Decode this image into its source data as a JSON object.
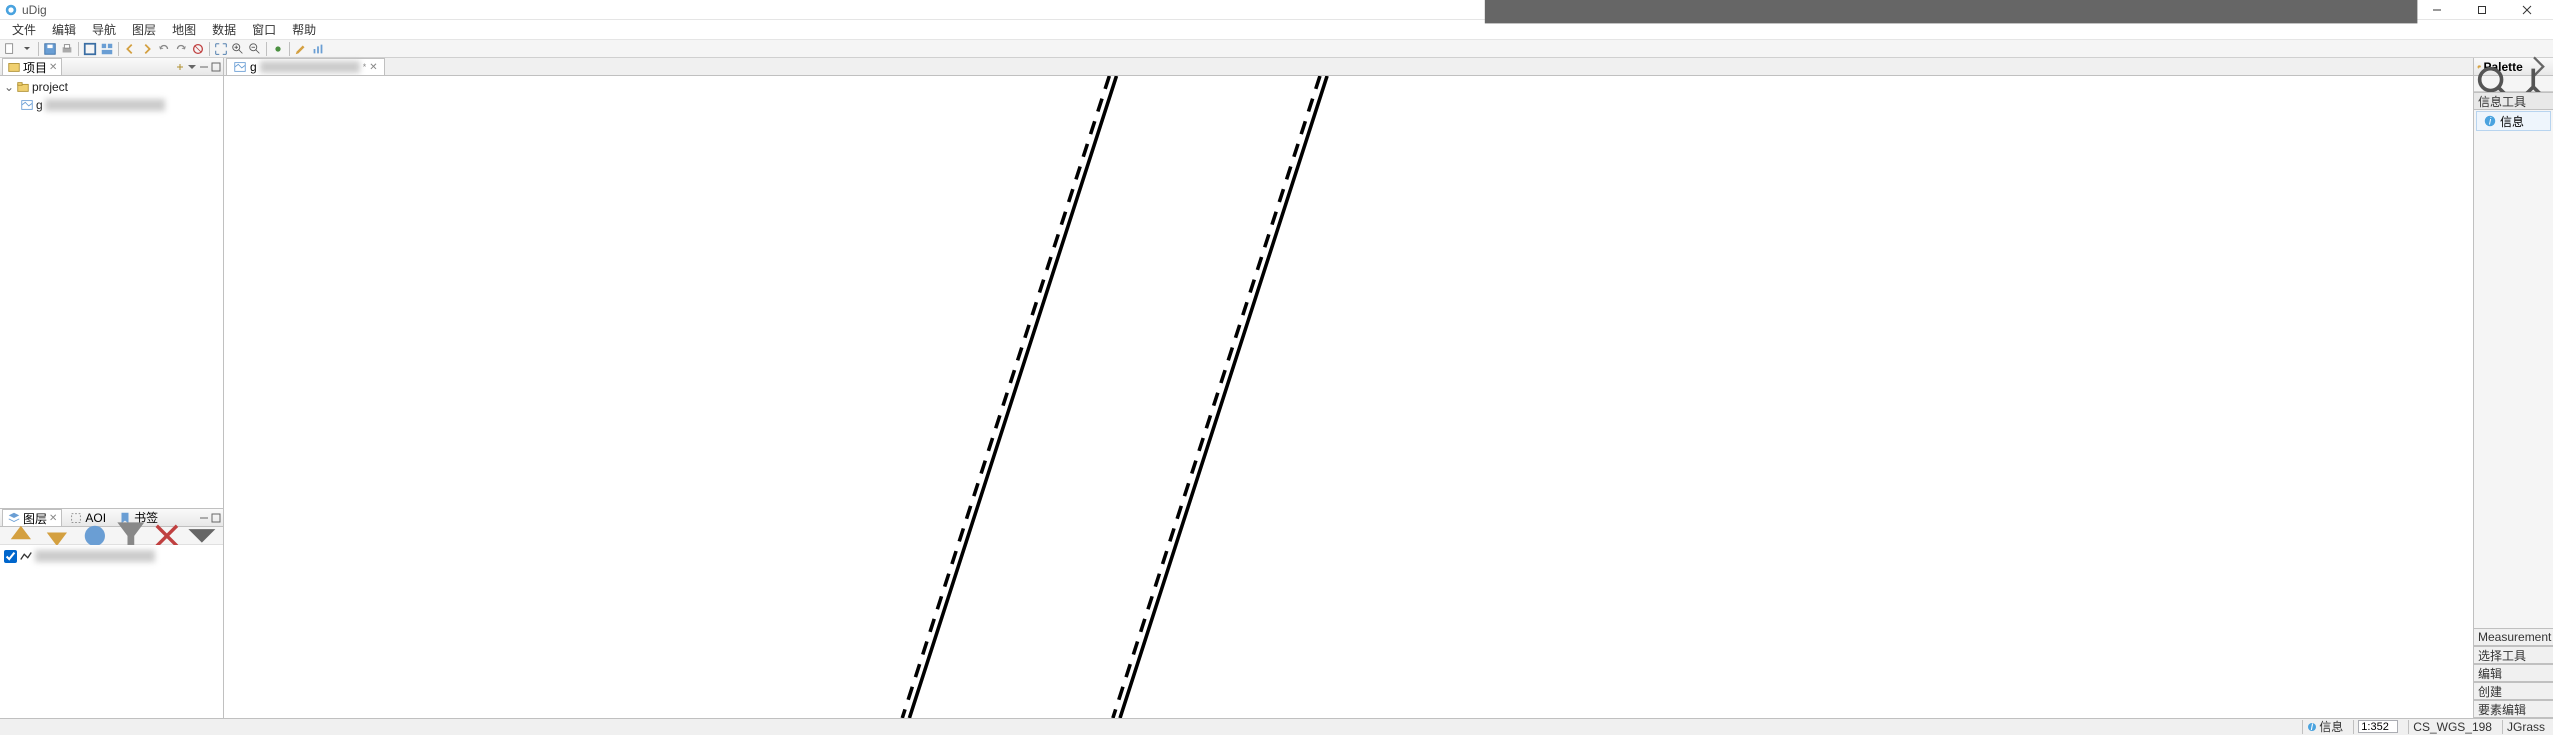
{
  "window": {
    "title": "uDig"
  },
  "menubar": [
    "文件",
    "编辑",
    "导航",
    "图层",
    "地图",
    "数据",
    "窗口",
    "帮助"
  ],
  "project_panel": {
    "tab_label": "项目",
    "tree": {
      "root": "project",
      "child_prefix": "g"
    }
  },
  "layers_panel": {
    "tabs": [
      "图层",
      "AOI",
      "书签"
    ]
  },
  "editor": {
    "tab_prefix": "g"
  },
  "palette": {
    "title": "Palette",
    "groups": {
      "info_tools": "信息工具",
      "info_item": "信息",
      "measurement": "Measurement",
      "select_tools": "选择工具",
      "edit": "编辑",
      "create": "创建",
      "feature_edit": "要素编辑"
    }
  },
  "statusbar": {
    "info": "信息",
    "scale": "1:352",
    "crs": "CS_WGS_198",
    "jgrass": "JGrass"
  }
}
